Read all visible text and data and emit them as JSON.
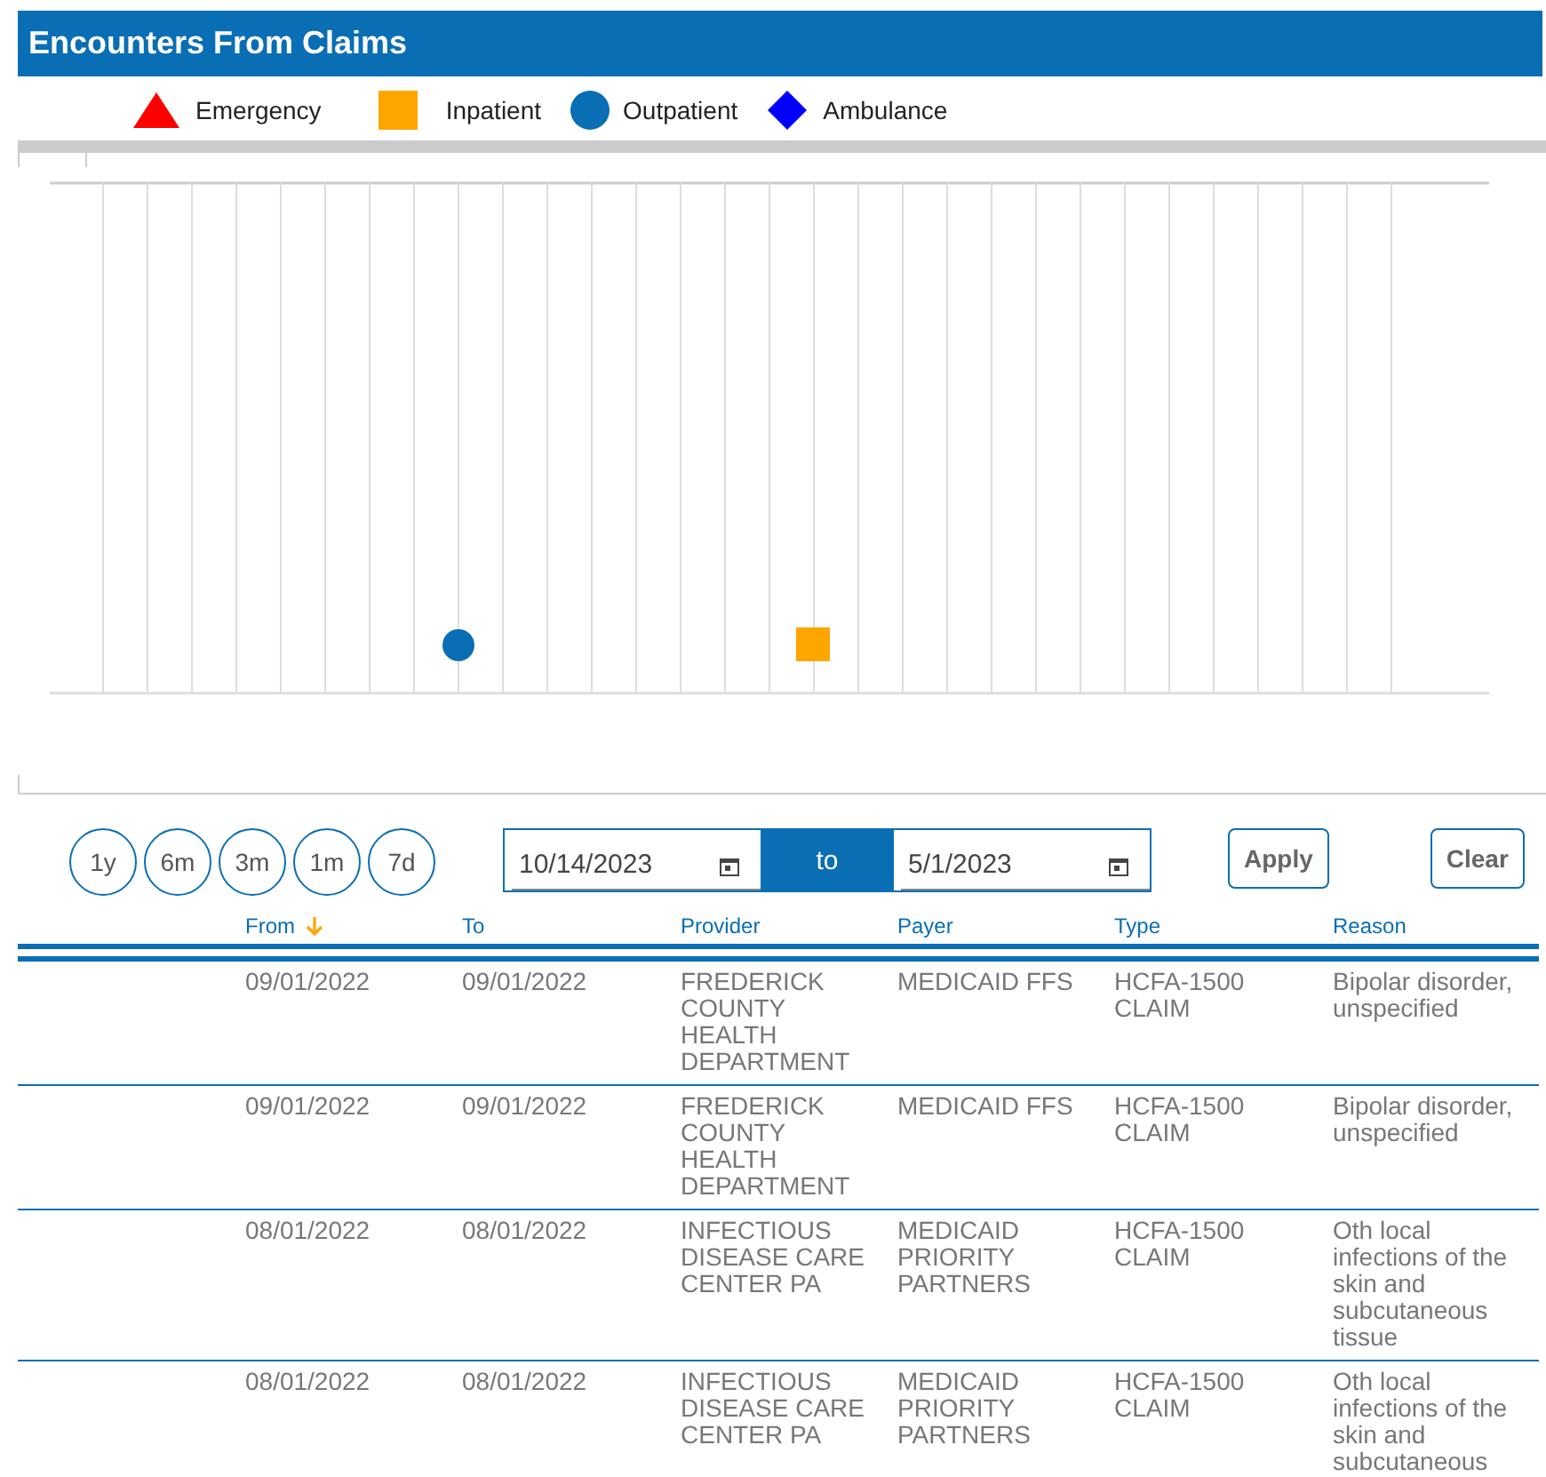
{
  "panel": {
    "title": "Encounters From Claims"
  },
  "legend": [
    {
      "label": "Emergency",
      "kind": "triangle",
      "color": "#ff0000"
    },
    {
      "label": "Inpatient",
      "kind": "square",
      "color": "#ffa500"
    },
    {
      "label": "Outpatient",
      "kind": "circle",
      "color": "#0a6eb4"
    },
    {
      "label": "Ambulance",
      "kind": "diamond",
      "color": "#0000ff"
    }
  ],
  "range_buttons": [
    "1y",
    "6m",
    "3m",
    "1m",
    "7d"
  ],
  "date_range": {
    "from": "10/14/2023",
    "separator": "to",
    "to": "5/1/2023"
  },
  "actions": [
    "Apply",
    "Clear"
  ],
  "table": {
    "columns": [
      {
        "label": "From",
        "sorted": true
      },
      {
        "label": "To",
        "sorted": false
      },
      {
        "label": "Provider",
        "sorted": false
      },
      {
        "label": "Payer",
        "sorted": false
      },
      {
        "label": "Type",
        "sorted": false
      },
      {
        "label": "Reason",
        "sorted": false
      }
    ],
    "rows": [
      [
        "09/01/2022",
        "09/01/2022",
        "FREDERICK COUNTY HEALTH DEPARTMENT",
        "MEDICAID FFS",
        "HCFA-1500 CLAIM",
        "Bipolar disorder, unspecified"
      ],
      [
        "09/01/2022",
        "09/01/2022",
        "FREDERICK COUNTY HEALTH DEPARTMENT",
        "MEDICAID FFS",
        "HCFA-1500 CLAIM",
        "Bipolar disorder, unspecified"
      ],
      [
        "08/01/2022",
        "08/01/2022",
        "INFECTIOUS DISEASE CARE CENTER PA",
        "MEDICAID PRIORITY PARTNERS",
        "HCFA-1500 CLAIM",
        "Oth local infections of the skin and subcutaneous tissue"
      ],
      [
        "08/01/2022",
        "08/01/2022",
        "INFECTIOUS DISEASE CARE CENTER PA",
        "MEDICAID PRIORITY PARTNERS",
        "HCFA-1500 CLAIM",
        "Oth local infections of the skin and subcutaneous"
      ]
    ]
  }
}
